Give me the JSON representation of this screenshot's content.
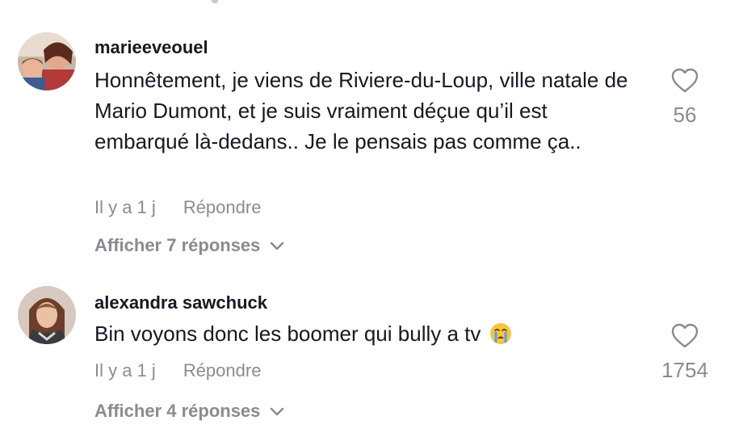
{
  "comments": [
    {
      "username": "marieeveouel",
      "text": "Honnêtement, je viens de Riviere-du-Loup, ville natale de Mario Dumont, et je suis vraiment déçue qu’il est embarqué là-dedans.. Je le pensais pas comme ça..",
      "time": "Il y a 1 j",
      "reply_label": "Répondre",
      "view_replies": "Afficher 7 réponses",
      "likes": "56"
    },
    {
      "username": "alexandra sawchuck",
      "text": "Bin voyons donc les boomer qui bully a tv",
      "emoji": "crying-face",
      "time": "Il y a 1 j",
      "reply_label": "Répondre",
      "view_replies": "Afficher 4 réponses",
      "likes": "1754"
    }
  ],
  "icons": {
    "like": "heart-outline-icon",
    "expand": "chevron-down-icon"
  },
  "colors": {
    "primary_text": "#161823",
    "secondary_text": "#8a8b91",
    "background": "#ffffff"
  }
}
